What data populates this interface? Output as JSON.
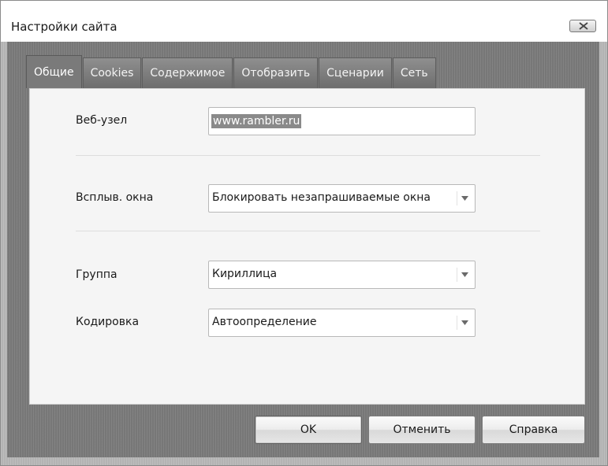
{
  "window": {
    "title": "Настройки сайта"
  },
  "tabs": [
    {
      "label": "Общие",
      "active": true
    },
    {
      "label": "Cookies",
      "active": false
    },
    {
      "label": "Содержимое",
      "active": false
    },
    {
      "label": "Отобразить",
      "active": false
    },
    {
      "label": "Сценарии",
      "active": false
    },
    {
      "label": "Сеть",
      "active": false
    }
  ],
  "general": {
    "site_label": "Веб-узел",
    "site_value": "www.rambler.ru",
    "popups_label": "Всплыв. окна",
    "popups_value": "Блокировать незапрашиваемые окна",
    "group_label": "Группа",
    "group_value": "Кириллица",
    "encoding_label": "Кодировка",
    "encoding_value": "Автоопределение"
  },
  "buttons": {
    "ok": "OK",
    "cancel": "Отменить",
    "help": "Справка"
  },
  "icons": {
    "close": "close-icon",
    "dropdown": "chevron-down-icon"
  }
}
